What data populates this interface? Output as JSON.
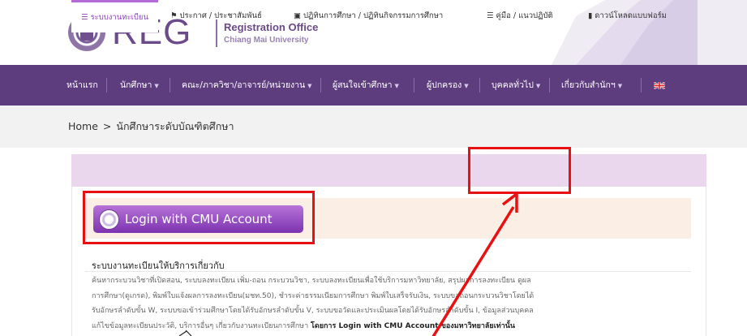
{
  "header": {
    "logo_text": "REG",
    "title": "Registration Office",
    "subtitle": "Chiang Mai University"
  },
  "nav": {
    "items": [
      {
        "label": "หน้าแรก",
        "dropdown": false
      },
      {
        "label": "นักศึกษา",
        "dropdown": true
      },
      {
        "label": "คณะ/ภาควิชา/อาจารย์/หน่วยงาน",
        "dropdown": true
      },
      {
        "label": "ผู้สนใจเข้าศึกษา",
        "dropdown": true
      },
      {
        "label": "ผู้ปกครอง",
        "dropdown": true
      },
      {
        "label": "บุคคลทั่วไป",
        "dropdown": true
      },
      {
        "label": "เกี่ยวกับสำนักฯ",
        "dropdown": true
      }
    ],
    "language_flag": "uk-flag-icon"
  },
  "breadcrumb": {
    "home": "Home",
    "separator": ">",
    "current": "นักศึกษาระดับบัณฑิตศึกษา"
  },
  "tabs": [
    {
      "label": "ระบบงานทะเบียน",
      "icon": "database-icon",
      "active": true
    },
    {
      "label": "ประกาศ / ประชาสัมพันธ์",
      "icon": "megaphone-icon",
      "active": false
    },
    {
      "label": "ปฏิทินการศึกษา / ปฏิทินกิจกรรมการศึกษา",
      "icon": "calendar-icon",
      "active": false
    },
    {
      "label": "คู่มือ / แนวปฏิบัติ",
      "icon": "list-icon",
      "active": false
    },
    {
      "label": "ดาวน์โหลดแบบฟอร์ม",
      "icon": "file-icon",
      "active": false
    }
  ],
  "login_button": {
    "label": "Login with CMU Account"
  },
  "info": {
    "title": "ระบบงานทะเบียนให้บริการเกี่ยวกับ",
    "lines": [
      "ค้นหากระบวนวิชาที่เปิดสอน, ระบบลงทะเบียน เพิ่ม-ถอน กระบวนวิชา, ระบบลงทะเบียนเพื่อใช้บริการมหาวิทยาลัย, สรุปผลการลงทะเบียน ดูผล",
      "การศึกษา(ดูเกรด), พิมพ์ใบแจ้งผลการลงทะเบียน(มชท.50), ชำระค่าธรรมเนียมการศึกษา พิมพ์ใบเสร็จรับเงิน, ระบบขอถอนกระบวนวิชาโดยได้",
      "รับอักษรลำดับขั้น W, ระบบขอเข้าร่วมศึกษาโดยได้รับอักษรลำดับขั้น V, ระบบขอวัดและประเมินผลโดยได้รับอักษรลำดับขั้น I, ข้อมูลส่วนบุคคล",
      "แก้ไขข้อมูลทะเบียนประวัติ, บริการอื่นๆ เกี่ยวกับงานทะเบียนการศึกษา"
    ],
    "emphasis": "โดยการ Login with CMU Account ของมหาวิทยาลัยเท่านั้น"
  },
  "colors": {
    "nav_bg": "#5e3d7f",
    "tabs_bg": "#ead7ee",
    "active_tab_accent": "#b46bd6",
    "login_band": "#fbeee4",
    "annotation_red": "#e81010"
  }
}
